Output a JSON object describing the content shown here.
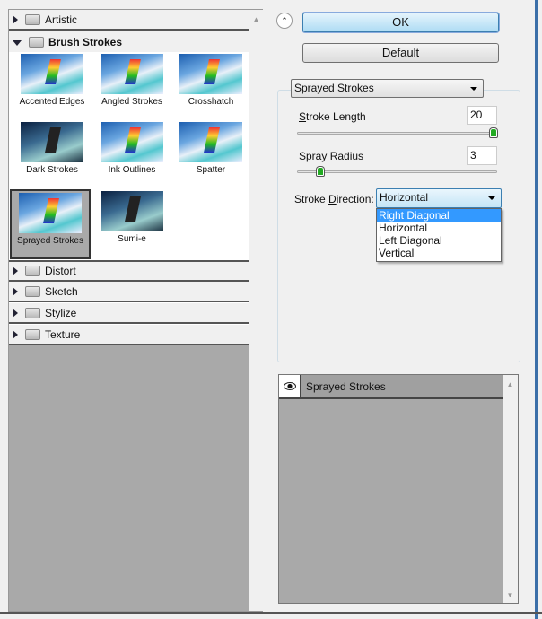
{
  "filter_gallery": {
    "categories": [
      {
        "label": "Artistic",
        "expanded": false
      },
      {
        "label": "Brush Strokes",
        "expanded": true
      },
      {
        "label": "Distort",
        "expanded": false
      },
      {
        "label": "Sketch",
        "expanded": false
      },
      {
        "label": "Stylize",
        "expanded": false
      },
      {
        "label": "Texture",
        "expanded": false
      }
    ],
    "brush_strokes_filters": [
      {
        "label": "Accented Edges"
      },
      {
        "label": "Angled Strokes"
      },
      {
        "label": "Crosshatch"
      },
      {
        "label": "Dark Strokes"
      },
      {
        "label": "Ink Outlines"
      },
      {
        "label": "Spatter"
      },
      {
        "label": "Sprayed Strokes",
        "selected": true
      },
      {
        "label": "Sumi-e"
      }
    ]
  },
  "buttons": {
    "ok": "OK",
    "default": "Default"
  },
  "settings": {
    "filter_select": "Sprayed Strokes",
    "stroke_length": {
      "label_pre": "",
      "label_u": "S",
      "label_post": "troke Length",
      "value": "20",
      "min": 0,
      "max": 20
    },
    "spray_radius": {
      "label_pre": "Spray ",
      "label_u": "R",
      "label_post": "adius",
      "value": "3",
      "min": 0,
      "max": 25
    },
    "stroke_direction": {
      "label_pre": "Stroke ",
      "label_u": "D",
      "label_post": "irection:",
      "value": "Horizontal",
      "options": [
        "Right Diagonal",
        "Horizontal",
        "Left Diagonal",
        "Vertical"
      ],
      "highlighted": "Right Diagonal"
    }
  },
  "layers": {
    "items": [
      {
        "label": "Sprayed Strokes",
        "visible": true
      }
    ]
  },
  "colors": {
    "accent": "#3399ff",
    "panel_gray": "#a9a9a9"
  }
}
